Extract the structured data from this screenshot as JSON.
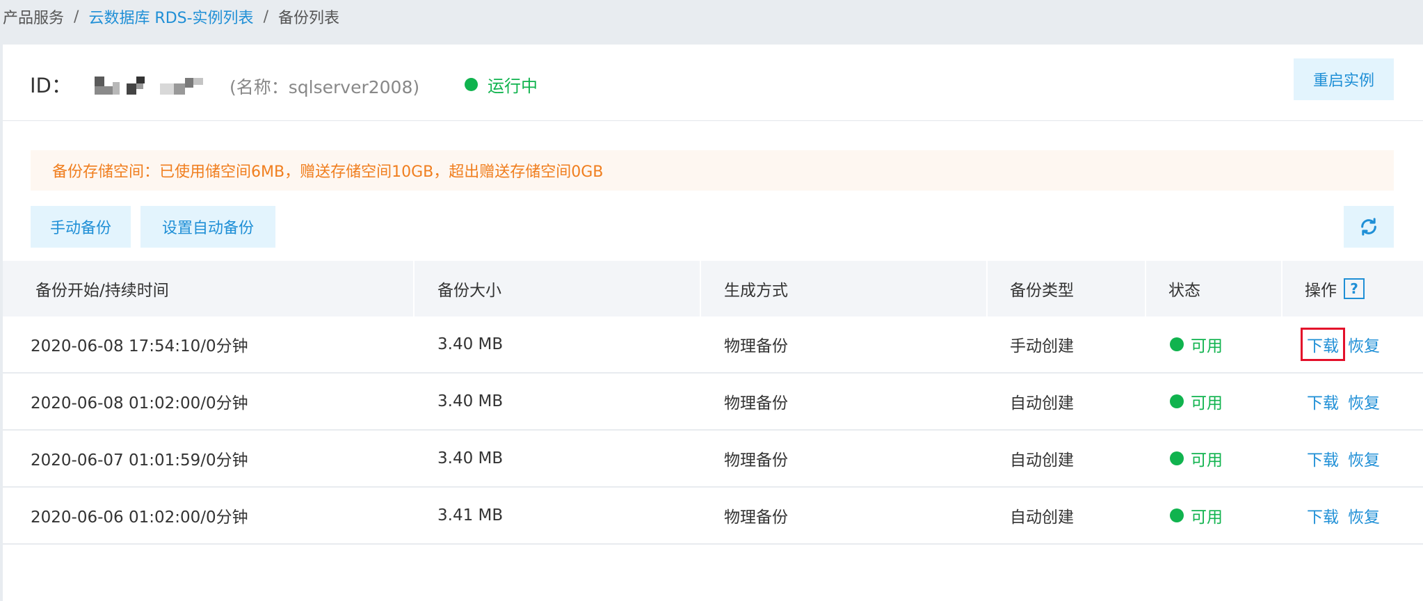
{
  "breadcrumb": {
    "home": "产品服务",
    "rds_list": "云数据库 RDS-实例列表",
    "current": "备份列表",
    "sep": "/"
  },
  "header": {
    "id_label": "ID：",
    "instance_name": "(名称：sqlserver2008)",
    "run_status": "运行中",
    "restart_label": "重启实例"
  },
  "notice": "备份存储空间：已使用储空间6MB，赠送存储空间10GB，超出赠送存储空间0GB",
  "toolbar": {
    "manual_backup": "手动备份",
    "auto_backup_settings": "设置自动备份"
  },
  "table": {
    "columns": [
      "备份开始/持续时间",
      "备份大小",
      "生成方式",
      "备份类型",
      "状态",
      "操作"
    ],
    "rows": [
      {
        "time": "2020-06-08 17:54:10/0分钟",
        "size": "3.40 MB",
        "method": "物理备份",
        "type": "手动创建",
        "status": "可用",
        "download": "下载",
        "restore": "恢复"
      },
      {
        "time": "2020-06-08 01:02:00/0分钟",
        "size": "3.40 MB",
        "method": "物理备份",
        "type": "自动创建",
        "status": "可用",
        "download": "下载",
        "restore": "恢复"
      },
      {
        "time": "2020-06-07 01:01:59/0分钟",
        "size": "3.40 MB",
        "method": "物理备份",
        "type": "自动创建",
        "status": "可用",
        "download": "下载",
        "restore": "恢复"
      },
      {
        "time": "2020-06-06 01:02:00/0分钟",
        "size": "3.41 MB",
        "method": "物理备份",
        "type": "自动创建",
        "status": "可用",
        "download": "下载",
        "restore": "恢复"
      }
    ]
  },
  "colors": {
    "accent": "#1f8fd6",
    "success": "#10b34e",
    "warning": "#f07e1e",
    "highlight": "#e3102a"
  },
  "icons": {
    "refresh": "refresh-icon",
    "help": "help-icon",
    "status": "status-dot-icon"
  }
}
